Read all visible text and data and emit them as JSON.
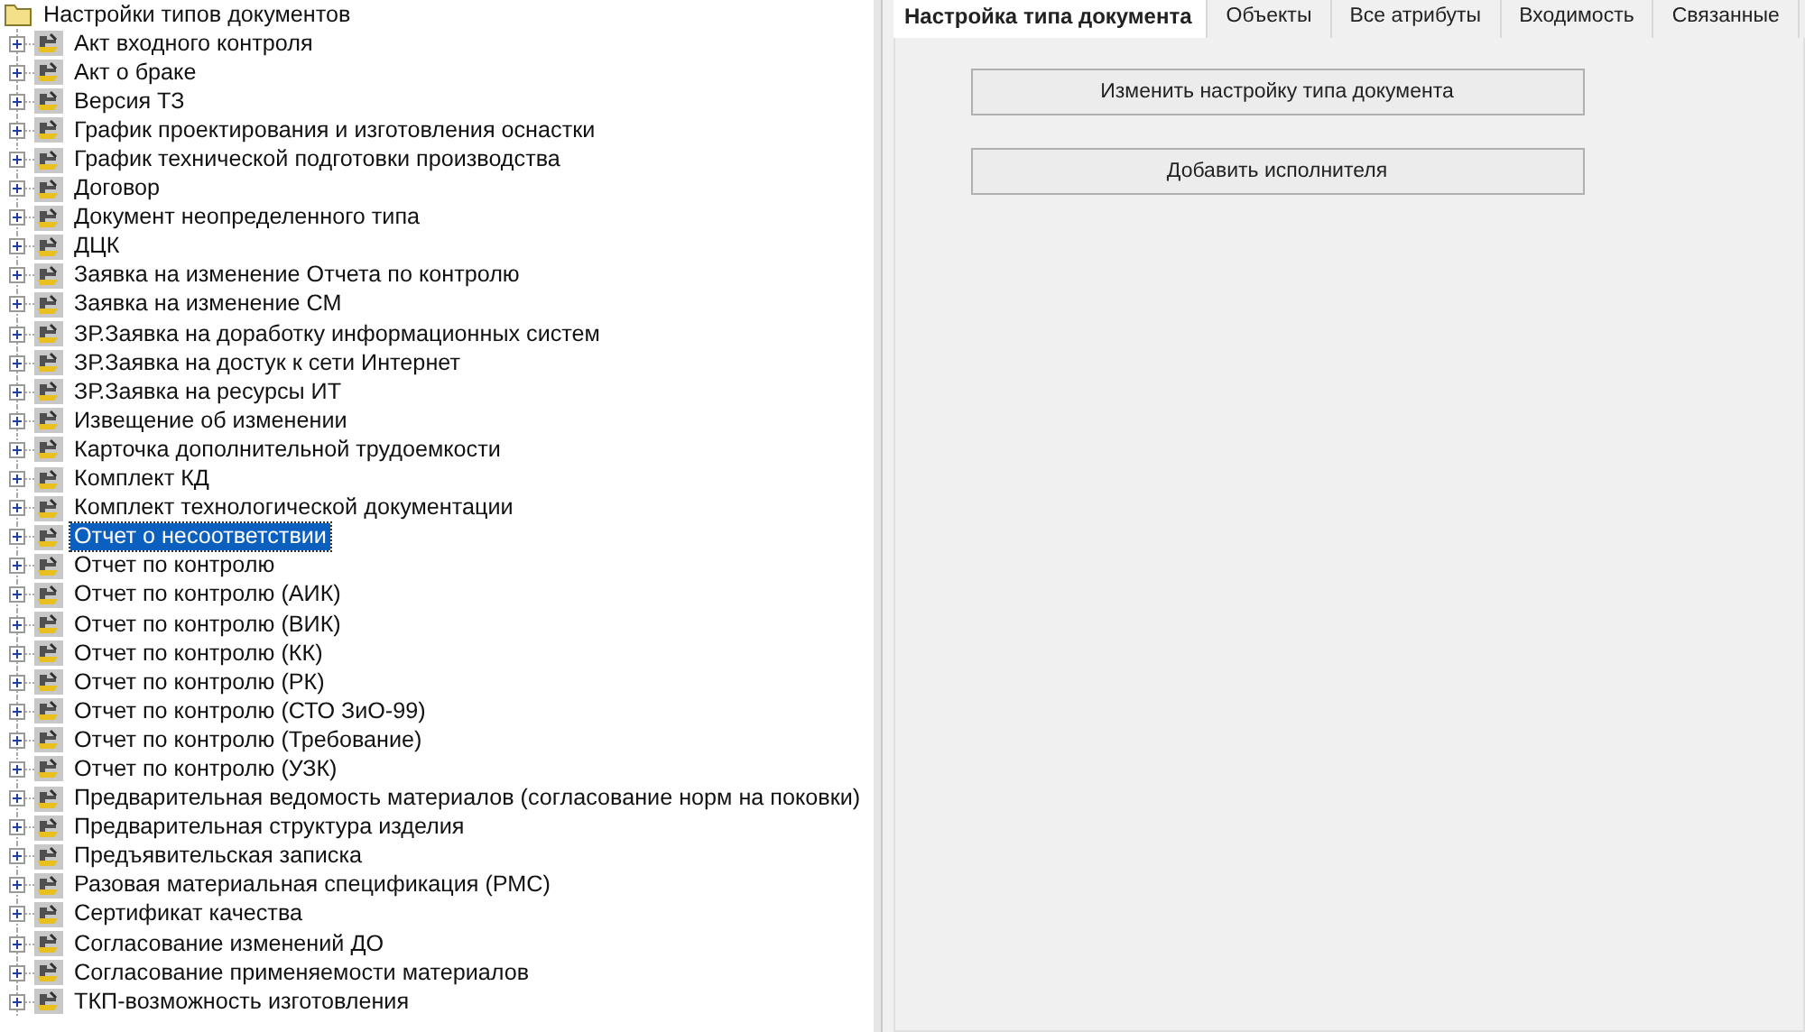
{
  "tree": {
    "label": "Настройки типов документов",
    "expanded": true,
    "children": [
      {
        "label": "Акт входного контроля",
        "expanded": false,
        "selected": false
      },
      {
        "label": "Акт о браке",
        "expanded": false,
        "selected": false
      },
      {
        "label": "Версия ТЗ",
        "expanded": false,
        "selected": false
      },
      {
        "label": "График проектирования и изготовления оснастки",
        "expanded": false,
        "selected": false
      },
      {
        "label": "График технической подготовки производства",
        "expanded": false,
        "selected": false
      },
      {
        "label": "Договор",
        "expanded": false,
        "selected": false
      },
      {
        "label": "Документ неопределенного типа",
        "expanded": false,
        "selected": false
      },
      {
        "label": "ДЦК",
        "expanded": false,
        "selected": false
      },
      {
        "label": "Заявка на изменение Отчета по контролю",
        "expanded": false,
        "selected": false
      },
      {
        "label": "Заявка на изменение СМ",
        "expanded": false,
        "selected": false
      },
      {
        "label": "ЗР.Заявка на доработку информационных систем",
        "expanded": false,
        "selected": false
      },
      {
        "label": "ЗР.Заявка на достук к сети Интернет",
        "expanded": false,
        "selected": false
      },
      {
        "label": "ЗР.Заявка на ресурсы ИТ",
        "expanded": false,
        "selected": false
      },
      {
        "label": "Извещение об изменении",
        "expanded": false,
        "selected": false
      },
      {
        "label": "Карточка дополнительной трудоемкости",
        "expanded": false,
        "selected": false
      },
      {
        "label": "Комплект КД",
        "expanded": false,
        "selected": false
      },
      {
        "label": "Комплект технологической документации",
        "expanded": false,
        "selected": false
      },
      {
        "label": "Отчет о несоответствии",
        "expanded": false,
        "selected": true
      },
      {
        "label": "Отчет по контролю",
        "expanded": false,
        "selected": false
      },
      {
        "label": "Отчет по контролю (АИК)",
        "expanded": false,
        "selected": false
      },
      {
        "label": "Отчет по контролю (ВИК)",
        "expanded": false,
        "selected": false
      },
      {
        "label": "Отчет по контролю (КК)",
        "expanded": false,
        "selected": false
      },
      {
        "label": "Отчет по контролю (РК)",
        "expanded": false,
        "selected": false
      },
      {
        "label": "Отчет по контролю (СТО ЗиО-99)",
        "expanded": false,
        "selected": false
      },
      {
        "label": "Отчет по контролю (Требование)",
        "expanded": false,
        "selected": false
      },
      {
        "label": "Отчет по контролю (УЗК)",
        "expanded": false,
        "selected": false
      },
      {
        "label": "Предварительная ведомость материалов (согласование норм на поковки)",
        "expanded": false,
        "selected": false
      },
      {
        "label": "Предварительная структура изделия",
        "expanded": false,
        "selected": false
      },
      {
        "label": "Предъявительская записка",
        "expanded": false,
        "selected": false
      },
      {
        "label": "Разовая материальная спецификация (РМС)",
        "expanded": false,
        "selected": false
      },
      {
        "label": "Сертификат качества",
        "expanded": false,
        "selected": false
      },
      {
        "label": "Согласование изменений ДО",
        "expanded": false,
        "selected": false
      },
      {
        "label": "Согласование применяемости материалов",
        "expanded": false,
        "selected": false
      },
      {
        "label": "ТКП-возможность изготовления",
        "expanded": false,
        "selected": false
      }
    ]
  },
  "tabs": [
    {
      "label": "Настройка типа документа",
      "selected": true
    },
    {
      "label": "Объекты",
      "selected": false
    },
    {
      "label": "Все атрибуты",
      "selected": false
    },
    {
      "label": "Входимость",
      "selected": false
    },
    {
      "label": "Связанные",
      "selected": false
    }
  ],
  "buttons": [
    "Изменить настройку типа документа",
    "Добавить исполнителя"
  ]
}
